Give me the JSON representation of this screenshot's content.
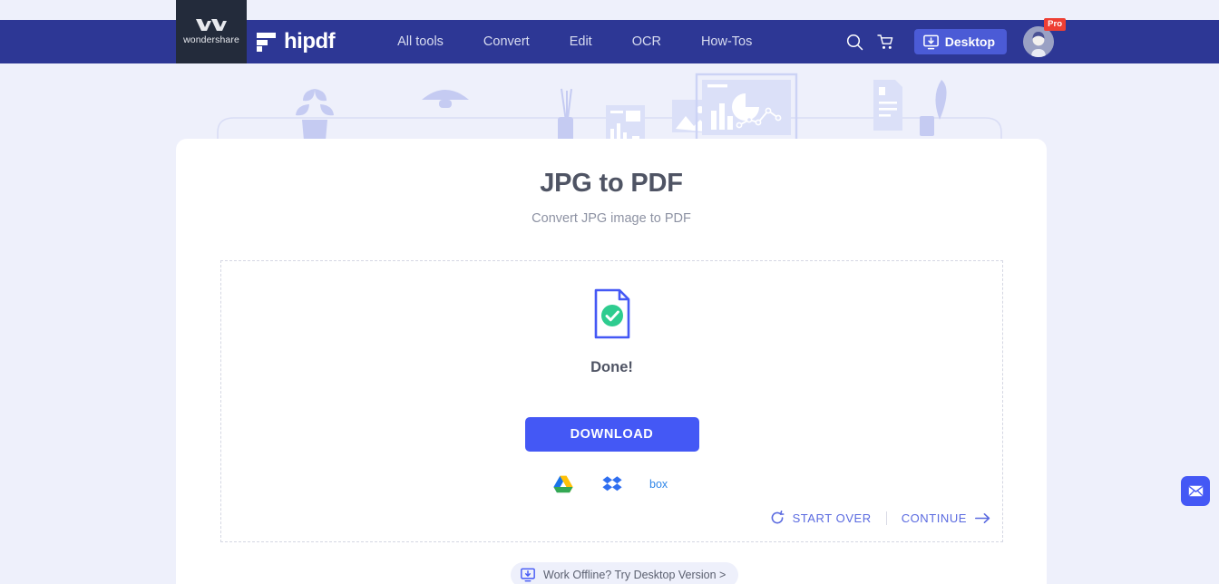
{
  "brand": {
    "wondershare_label": "wondershare",
    "hipdf_label": "hipdf"
  },
  "nav": {
    "links": [
      {
        "label": "All tools"
      },
      {
        "label": "Convert"
      },
      {
        "label": "Edit"
      },
      {
        "label": "OCR"
      },
      {
        "label": "How-Tos"
      }
    ],
    "search_icon": "search-icon",
    "cart_icon": "cart-icon",
    "desktop_button": "Desktop",
    "desktop_icon": "monitor-download-icon",
    "account_badge": "Pro",
    "avatar_icon": "user-avatar"
  },
  "main": {
    "title": "JPG to PDF",
    "subtitle": "Convert JPG image to PDF",
    "status_text": "Done!",
    "status_icon": "document-check-icon",
    "download_label": "DOWNLOAD",
    "cloud_targets": [
      {
        "name": "google-drive",
        "label": "Google Drive"
      },
      {
        "name": "dropbox",
        "label": "Dropbox"
      },
      {
        "name": "box",
        "label": "box"
      }
    ],
    "start_over_label": "START OVER",
    "start_over_icon": "refresh-icon",
    "continue_label": "CONTINUE",
    "continue_icon": "arrow-right-icon"
  },
  "footer": {
    "offline_label": "Work Offline? Try Desktop Version >",
    "offline_icon": "monitor-download-icon"
  },
  "floating": {
    "feedback_icon": "envelope-icon"
  },
  "colors": {
    "nav_bg": "#2d3795",
    "page_bg": "#eef0fb",
    "accent": "#4458f5",
    "success": "#2ecc8f",
    "pro_badge": "#ee3f34",
    "wondershare_bg": "#232b3b"
  }
}
